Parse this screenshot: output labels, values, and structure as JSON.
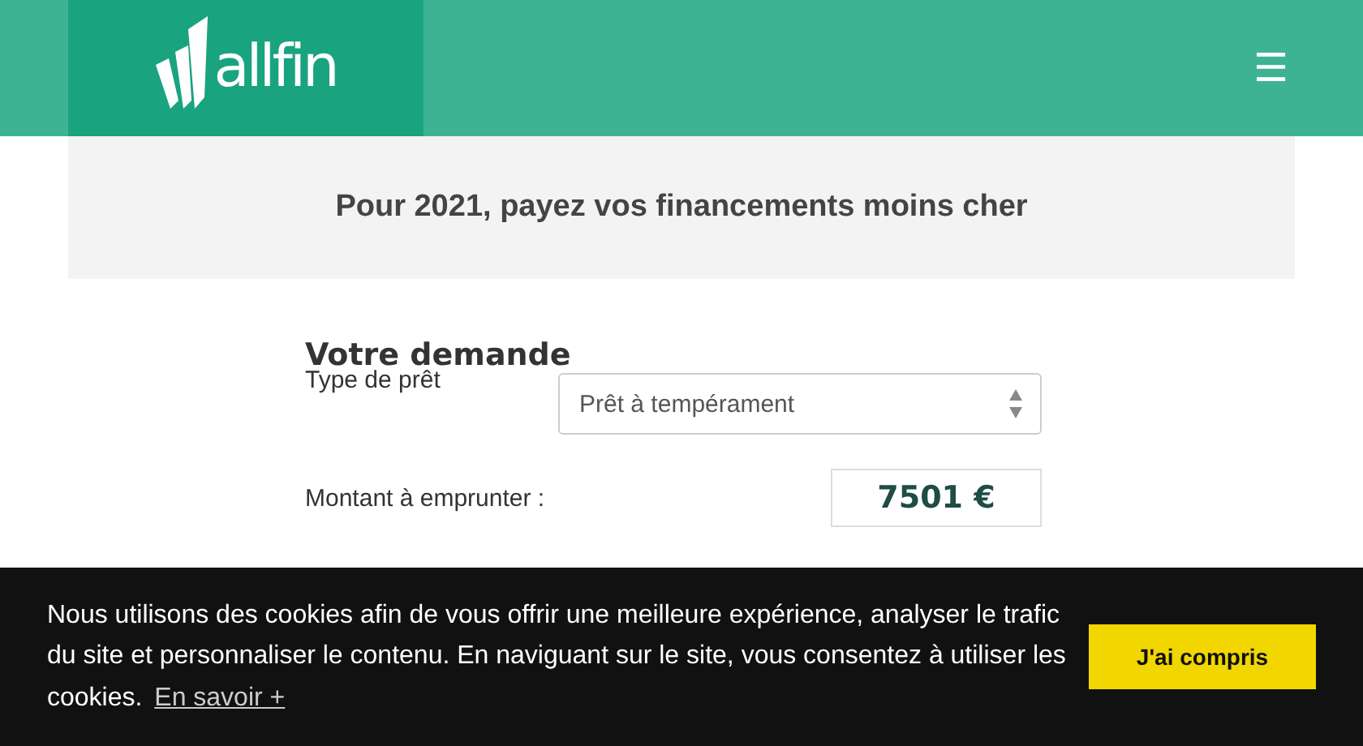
{
  "header": {
    "logo_text": "allfin",
    "menu_icon": "☰"
  },
  "promo": {
    "text": "Pour 2021, payez vos financements moins cher"
  },
  "form": {
    "heading": "Votre demande",
    "loan_type": {
      "label": "Type de prêt",
      "value": "Prêt à tempérament"
    },
    "amount": {
      "label": "Montant à emprunter :",
      "value": "7501 €"
    }
  },
  "cookie_bar": {
    "message": "Nous utilisons des cookies afin de vous offrir une meilleure expérience, analyser le trafic du site et personnaliser le contenu. En naviguant sur le site, vous consentez à utiliser les cookies.",
    "link": "En savoir +",
    "button": "J'ai compris"
  }
}
